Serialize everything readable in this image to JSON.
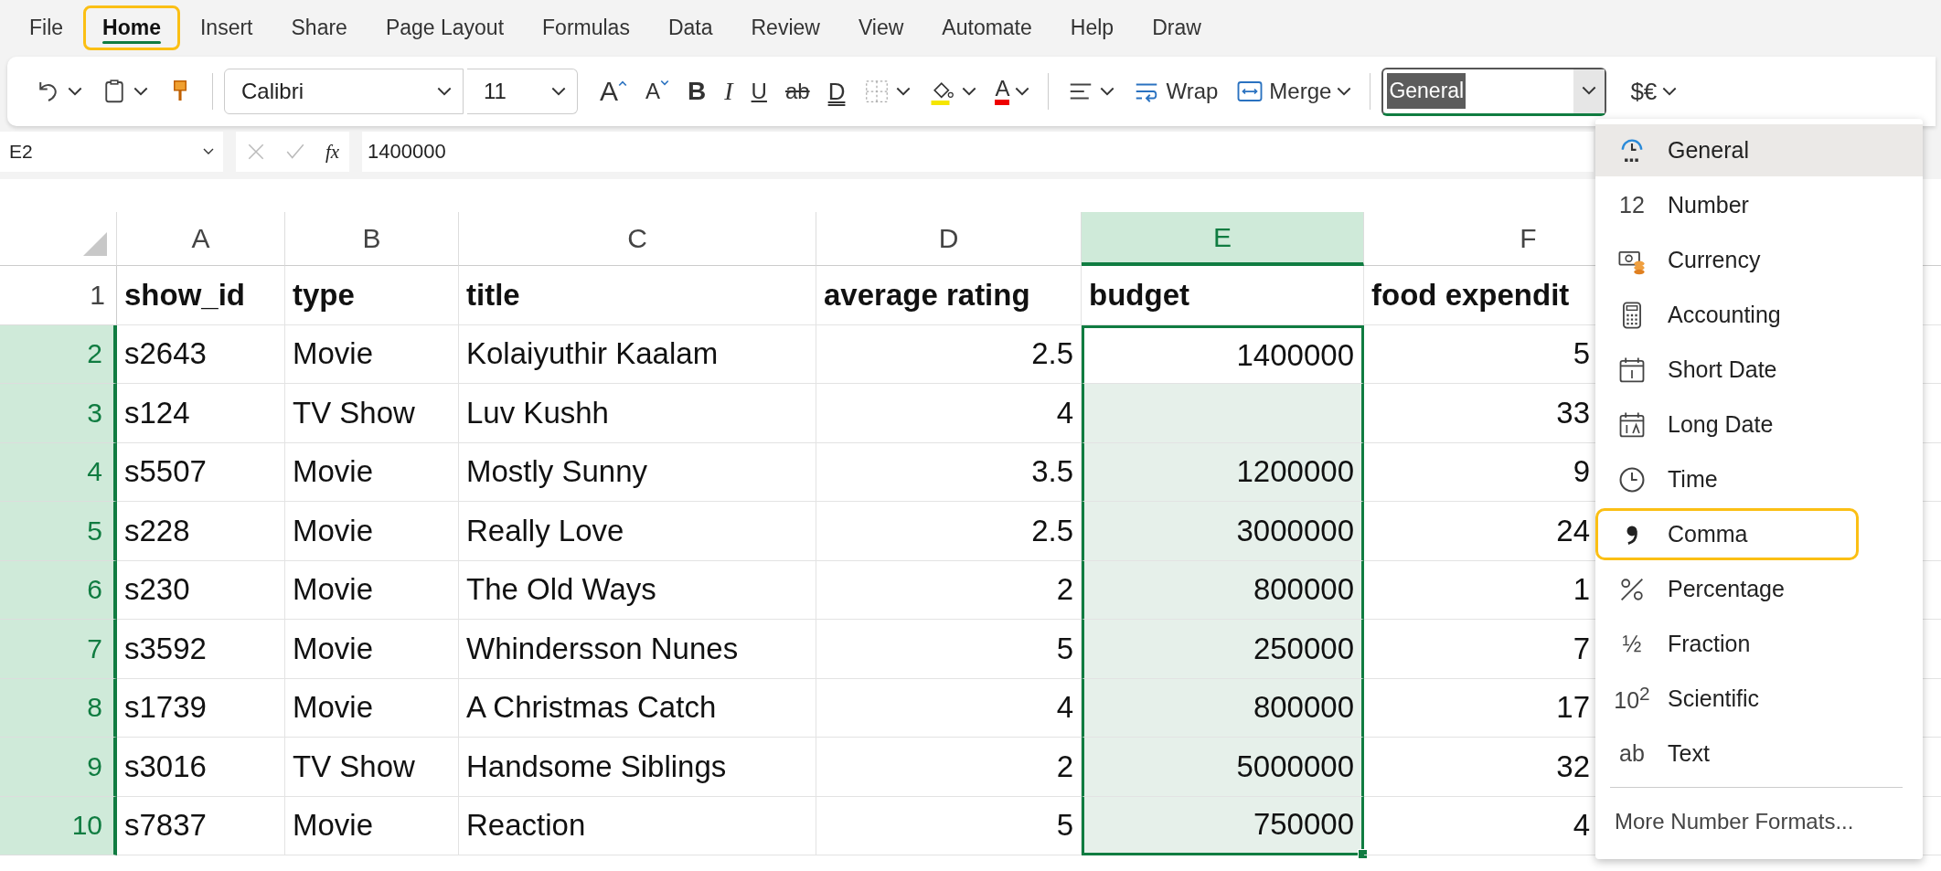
{
  "menu_tabs": [
    {
      "label": "File",
      "selected": false,
      "annotated": false
    },
    {
      "label": "Home",
      "selected": true,
      "annotated": true
    },
    {
      "label": "Insert",
      "selected": false,
      "annotated": false
    },
    {
      "label": "Share",
      "selected": false,
      "annotated": false
    },
    {
      "label": "Page Layout",
      "selected": false,
      "annotated": false
    },
    {
      "label": "Formulas",
      "selected": false,
      "annotated": false
    },
    {
      "label": "Data",
      "selected": false,
      "annotated": false
    },
    {
      "label": "Review",
      "selected": false,
      "annotated": false
    },
    {
      "label": "View",
      "selected": false,
      "annotated": false
    },
    {
      "label": "Automate",
      "selected": false,
      "annotated": false
    },
    {
      "label": "Help",
      "selected": false,
      "annotated": false
    },
    {
      "label": "Draw",
      "selected": false,
      "annotated": false
    }
  ],
  "ribbon": [
    {
      "kind": "undo",
      "dropdown": true
    },
    {
      "kind": "paste",
      "dropdown": true
    },
    {
      "kind": "painter"
    },
    {
      "kind": "separator"
    },
    {
      "kind": "font",
      "value": "Calibri"
    },
    {
      "kind": "size",
      "value": "11"
    },
    {
      "kind": "grow",
      "glyph": "A"
    },
    {
      "kind": "shrink",
      "glyph": "A"
    },
    {
      "kind": "bold",
      "glyph": "B"
    },
    {
      "kind": "italic",
      "glyph": "I"
    },
    {
      "kind": "underline",
      "glyph": "U"
    },
    {
      "kind": "strike",
      "glyph": "ab"
    },
    {
      "kind": "dunderline",
      "glyph": "D"
    },
    {
      "kind": "borders",
      "dropdown": true
    },
    {
      "kind": "fill",
      "dropdown": true
    },
    {
      "kind": "fontcolor",
      "glyph": "A",
      "dropdown": true
    },
    {
      "kind": "separator"
    },
    {
      "kind": "align",
      "dropdown": true
    },
    {
      "kind": "wrap",
      "label": "Wrap"
    },
    {
      "kind": "merge",
      "label": "Merge",
      "dropdown": true
    },
    {
      "kind": "separator"
    },
    {
      "kind": "format",
      "value": "General"
    },
    {
      "kind": "currency",
      "glyph": "$€",
      "dropdown": true
    }
  ],
  "formula_bar": {
    "name_box": "E2",
    "fx": "fx",
    "value": "1400000"
  },
  "columns": [
    {
      "label": "A",
      "selected": false,
      "numeric": false
    },
    {
      "label": "B",
      "selected": false,
      "numeric": false
    },
    {
      "label": "C",
      "selected": false,
      "numeric": false
    },
    {
      "label": "D",
      "selected": false,
      "numeric": true
    },
    {
      "label": "E",
      "selected": true,
      "numeric": true
    },
    {
      "label": "F",
      "selected": false,
      "numeric": true
    }
  ],
  "rows": [
    {
      "number": "1",
      "selected": false,
      "active": false,
      "header": true,
      "cells": [
        "show_id",
        "type",
        "title",
        "average rating",
        "budget",
        "food expendit"
      ]
    },
    {
      "number": "2",
      "selected": true,
      "active": true,
      "header": false,
      "cells": [
        "s2643",
        "Movie",
        "Kolaiyuthir Kaalam",
        "2.5",
        "1400000",
        "5"
      ]
    },
    {
      "number": "3",
      "selected": true,
      "active": false,
      "header": false,
      "cells": [
        "s124",
        "TV Show",
        "Luv Kushh",
        "4",
        null,
        "33"
      ]
    },
    {
      "number": "4",
      "selected": true,
      "active": false,
      "header": false,
      "cells": [
        "s5507",
        "Movie",
        "Mostly Sunny",
        "3.5",
        "1200000",
        "9"
      ]
    },
    {
      "number": "5",
      "selected": true,
      "active": false,
      "header": false,
      "cells": [
        "s228",
        "Movie",
        "Really Love",
        "2.5",
        "3000000",
        "24"
      ]
    },
    {
      "number": "6",
      "selected": true,
      "active": false,
      "header": false,
      "cells": [
        "s230",
        "Movie",
        "The Old Ways",
        "2",
        "800000",
        "1"
      ]
    },
    {
      "number": "7",
      "selected": true,
      "active": false,
      "header": false,
      "cells": [
        "s3592",
        "Movie",
        "Whindersson Nunes",
        "5",
        "250000",
        "7"
      ]
    },
    {
      "number": "8",
      "selected": true,
      "active": false,
      "header": false,
      "cells": [
        "s1739",
        "Movie",
        "A Christmas Catch",
        "4",
        "800000",
        "17"
      ]
    },
    {
      "number": "9",
      "selected": true,
      "active": false,
      "header": false,
      "cells": [
        "s3016",
        "TV Show",
        "Handsome Siblings",
        "2",
        "5000000",
        "32"
      ]
    },
    {
      "number": "10",
      "selected": true,
      "active": false,
      "header": false,
      "cells": [
        "s7837",
        "Movie",
        "Reaction",
        "5",
        "750000",
        "4"
      ]
    }
  ],
  "format_menu": {
    "items": [
      {
        "kind": "general",
        "label": "General",
        "selected": true,
        "annotated": false
      },
      {
        "kind": "number",
        "glyph": "12",
        "label": "Number",
        "selected": false,
        "annotated": false
      },
      {
        "kind": "currency",
        "label": "Currency",
        "selected": false,
        "annotated": false
      },
      {
        "kind": "accounting",
        "label": "Accounting",
        "selected": false,
        "annotated": false
      },
      {
        "kind": "shortdate",
        "label": "Short Date",
        "selected": false,
        "annotated": false
      },
      {
        "kind": "longdate",
        "label": "Long Date",
        "selected": false,
        "annotated": false
      },
      {
        "kind": "time",
        "label": "Time",
        "selected": false,
        "annotated": false
      },
      {
        "kind": "comma",
        "label": "Comma",
        "selected": false,
        "annotated": true
      },
      {
        "kind": "percentage",
        "label": "Percentage",
        "selected": false,
        "annotated": false
      },
      {
        "kind": "fraction",
        "glyph": "½",
        "label": "Fraction",
        "selected": false,
        "annotated": false
      },
      {
        "kind": "scientific",
        "glyph": "10$^{2}$",
        "label": "Scientific",
        "selected": false,
        "annotated": false
      },
      {
        "kind": "text",
        "glyph": "ab",
        "label": "Text",
        "selected": false,
        "annotated": false
      }
    ],
    "more": "More Number Formats..."
  }
}
